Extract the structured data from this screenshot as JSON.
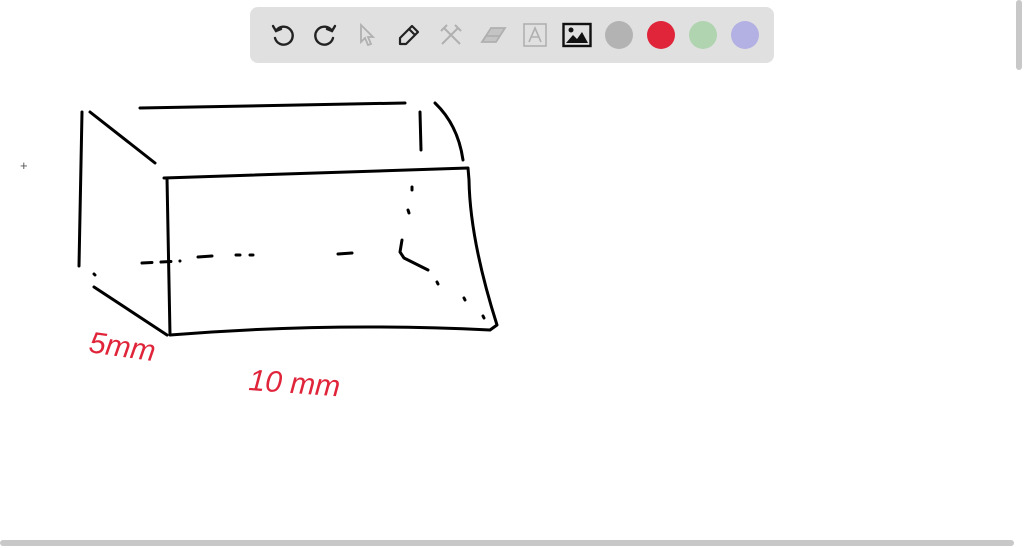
{
  "toolbar": {
    "tools": [
      "undo-icon",
      "redo-icon",
      "select-icon",
      "pen-icon",
      "shapes-icon",
      "eraser-icon",
      "text-icon",
      "image-icon"
    ],
    "colors": [
      "#b3b3b3",
      "#e0243a",
      "#b0d4b0",
      "#b3b0e3"
    ],
    "selected_color": "#e0243a"
  },
  "drawing": {
    "labels": {
      "width": "5mm",
      "length": "10 mm"
    },
    "ink_color": "#000000",
    "label_color": "#e0243a"
  }
}
